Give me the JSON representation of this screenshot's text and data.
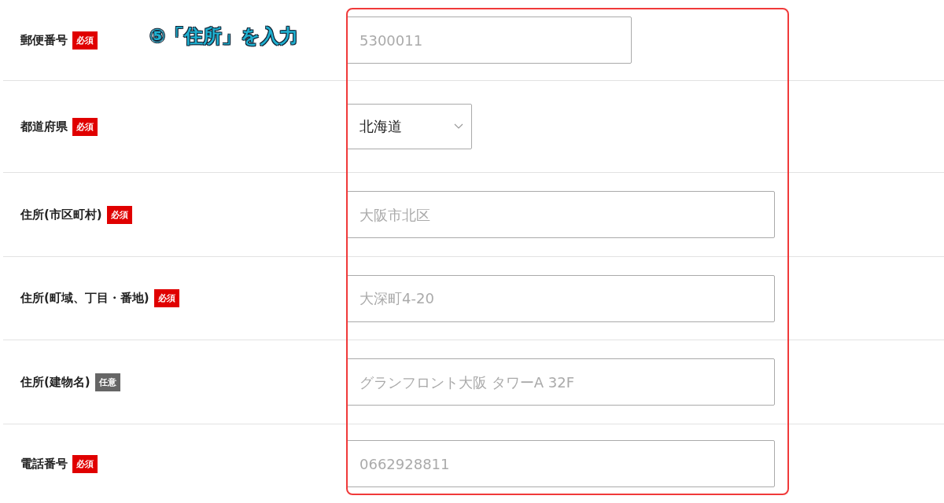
{
  "annotation": "⑤「住所」を入力",
  "rows": [
    {
      "label": "郵便番号",
      "badge": {
        "kind": "required",
        "text": "必須"
      },
      "field": {
        "kind": "short_text",
        "placeholder": "5300011"
      }
    },
    {
      "label": "都道府県",
      "badge": {
        "kind": "required",
        "text": "必須"
      },
      "field": {
        "kind": "select",
        "value": "北海道"
      }
    },
    {
      "label": "住所(市区町村)",
      "badge": {
        "kind": "required",
        "text": "必須"
      },
      "field": {
        "kind": "text",
        "placeholder": "大阪市北区"
      }
    },
    {
      "label": "住所(町域、丁目・番地)",
      "badge": {
        "kind": "required",
        "text": "必須"
      },
      "field": {
        "kind": "text",
        "placeholder": "大深町4-20"
      }
    },
    {
      "label": "住所(建物名)",
      "badge": {
        "kind": "optional",
        "text": "任意"
      },
      "field": {
        "kind": "text",
        "placeholder": "グランフロント大阪 タワーA 32F"
      }
    },
    {
      "label": "電話番号",
      "badge": {
        "kind": "required",
        "text": "必須"
      },
      "field": {
        "kind": "text",
        "placeholder": "0662928811"
      }
    }
  ]
}
